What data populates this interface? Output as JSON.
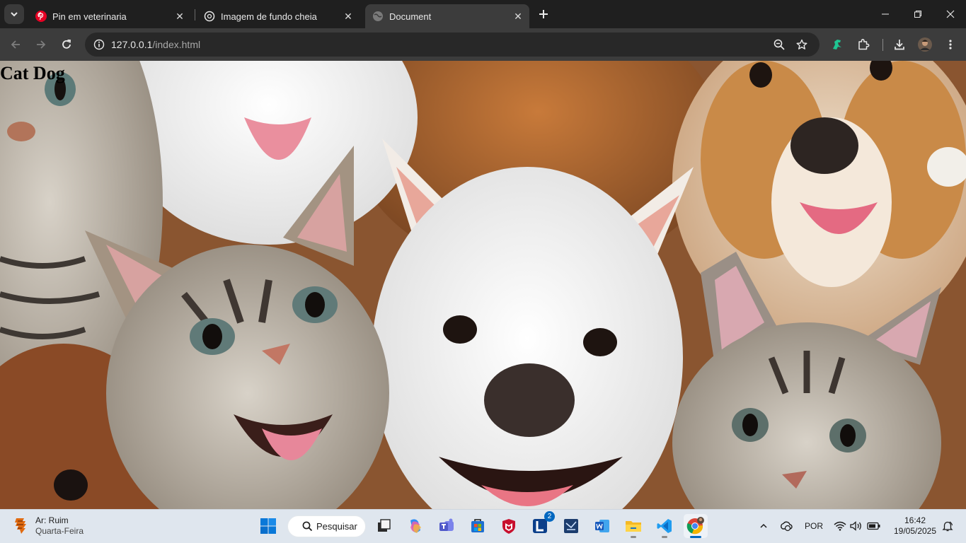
{
  "browser": {
    "tabs": [
      {
        "title": "Pin em veterinaria",
        "favicon": "pinterest-icon",
        "active": false
      },
      {
        "title": "Imagem de fundo cheia",
        "favicon": "openai-icon",
        "active": false
      },
      {
        "title": "Document",
        "favicon": "globe-icon",
        "active": true
      }
    ],
    "address": {
      "host": "127.0.0.1",
      "path": "/index.html"
    }
  },
  "page": {
    "heading": "Cat Dog",
    "background": "photo-of-cats-and-dogs"
  },
  "taskbar": {
    "weather": {
      "line1": "Ar: Ruim",
      "line2": "Quarta-Feira"
    },
    "search_label": "Pesquisar",
    "lang": "POR",
    "time": "16:42",
    "date": "19/05/2025",
    "lens_badge": "2",
    "apps": [
      "start-icon",
      "task-view-icon",
      "copilot-icon",
      "teams-icon",
      "store-icon",
      "mcafee-icon",
      "l-app-icon",
      "vs-icon",
      "word-icon",
      "file-explorer-icon",
      "vscode-icon",
      "chrome-icon"
    ]
  },
  "colors": {
    "accent": "#0067c0",
    "chrome_bg": "#1f1f1f",
    "toolbar_bg": "#3c3c3c"
  }
}
